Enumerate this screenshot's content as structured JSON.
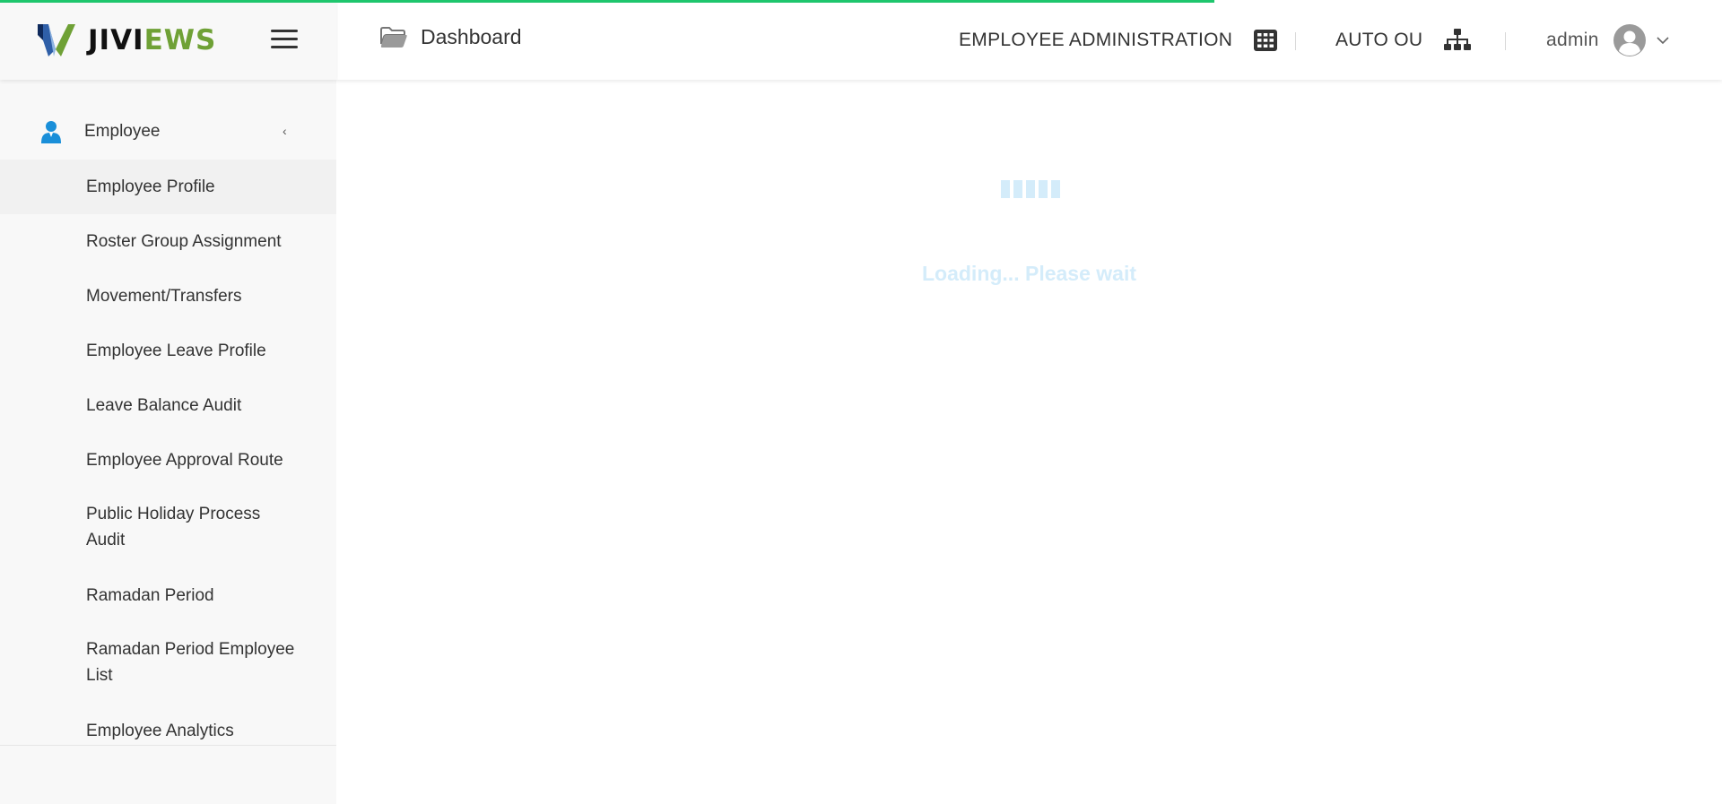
{
  "brand": {
    "name_part1": "JIVI",
    "name_part2": "EWS"
  },
  "header": {
    "breadcrumb": "Dashboard",
    "module": "EMPLOYEE ADMINISTRATION",
    "org_unit": "AUTO OU",
    "user": "admin"
  },
  "sidebar": {
    "parent": {
      "label": "Employee",
      "expanded": true
    },
    "items": [
      {
        "label": "Employee Profile"
      },
      {
        "label": "Roster Group Assignment"
      },
      {
        "label": "Movement/Transfers"
      },
      {
        "label": "Employee Leave Profile"
      },
      {
        "label": "Leave Balance Audit"
      },
      {
        "label": "Employee Approval Route"
      },
      {
        "label": "Public Holiday Process Audit"
      },
      {
        "label": "Ramadan Period"
      },
      {
        "label": "Ramadan Period Employee List"
      },
      {
        "label": "Employee Analytics"
      }
    ]
  },
  "main": {
    "loading_text": "Loading... Please wait"
  },
  "page_load_progress": 0.705,
  "colors": {
    "accent": "#1ec66d",
    "brand_green": "#6fa136",
    "icon_blue": "#1a8fd9",
    "loader": "#d4ecfa"
  }
}
